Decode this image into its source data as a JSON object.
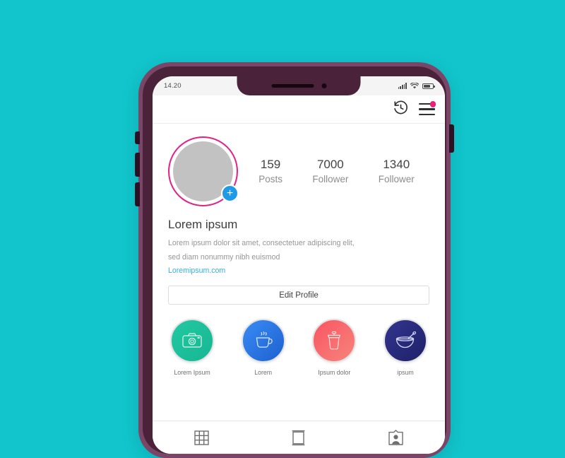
{
  "background_color": "#12c5cc",
  "phone": {
    "frame_color": "#4a2239",
    "frame_outer_color": "#7a4667",
    "buttons": {
      "silent": "silent-switch",
      "volume_up": "volume-up-button",
      "volume_down": "volume-down-button",
      "power": "power-button"
    }
  },
  "status_bar": {
    "time": "14.20",
    "icons": [
      "signal-icon",
      "wifi-icon",
      "battery-icon"
    ]
  },
  "header": {
    "icons": [
      {
        "name": "history-clock-icon"
      },
      {
        "name": "menu-icon",
        "badge": true,
        "badge_color": "#ed1e79"
      }
    ]
  },
  "profile": {
    "avatar": {
      "name": "avatar",
      "ring_color": "#e0218a",
      "fill_color": "#c2c2c2",
      "add_badge": {
        "name": "add-story-button",
        "label": "+",
        "color": "#1f9ae8"
      }
    },
    "stats": [
      {
        "value": "159",
        "label": "Posts"
      },
      {
        "value": "7000",
        "label": "Follower"
      },
      {
        "value": "1340",
        "label": "Follower"
      }
    ],
    "name": "Lorem ipsum",
    "bio_lines": [
      "Lorem ipsum dolor sit amet, consectetuer adipiscing elit,",
      "sed diam nonummy nibh euismod"
    ],
    "link": "Loremipsum.com",
    "link_color": "#3aaee0",
    "edit_button_label": "Edit Profile"
  },
  "highlights": [
    {
      "label": "Lorem Ipsum",
      "icon": "camera-icon",
      "color_from": "#22c9a2",
      "color_to": "#17b694"
    },
    {
      "label": "Lorem",
      "icon": "coffee-cup-icon",
      "color_from": "#2f80f0",
      "color_to": "#1c61cf"
    },
    {
      "label": "Ipsum dolor",
      "icon": "togo-cup-icon",
      "color_from": "#fa5464",
      "color_to": "#f67f70"
    },
    {
      "label": "ipsum",
      "icon": "bowl-spoon-icon",
      "color_from": "#2c2f8c",
      "color_to": "#1e2068"
    }
  ],
  "bottom_nav": [
    {
      "name": "nav-grid",
      "icon": "grid-icon"
    },
    {
      "name": "nav-list",
      "icon": "portrait-feed-icon"
    },
    {
      "name": "nav-tagged",
      "icon": "tagged-person-icon"
    }
  ]
}
